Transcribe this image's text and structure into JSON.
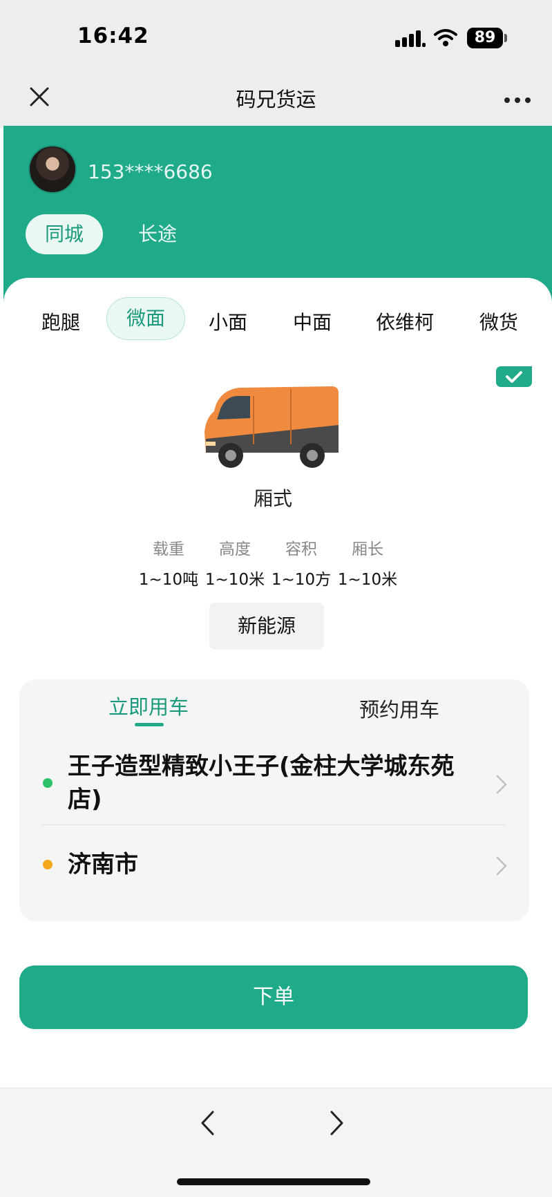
{
  "status_bar": {
    "time": "16:42",
    "battery": "89",
    "icons": [
      "signal-icon",
      "wifi-icon",
      "battery-icon"
    ]
  },
  "nav": {
    "title": "码兄货运",
    "close_icon": "close-icon",
    "more_icon": "more-icon"
  },
  "user": {
    "phone": "153****6686"
  },
  "trip_tabs": [
    {
      "label": "同城",
      "active": true
    },
    {
      "label": "长途",
      "active": false
    }
  ],
  "vehicle_types": [
    {
      "label": "跑腿",
      "active": false
    },
    {
      "label": "微面",
      "active": true
    },
    {
      "label": "小面",
      "active": false
    },
    {
      "label": "中面",
      "active": false
    },
    {
      "label": "依维柯",
      "active": false
    },
    {
      "label": "微货",
      "active": false
    }
  ],
  "vehicle": {
    "name": "厢式",
    "selected_icon": "check-icon",
    "van_color": "#f08a3e",
    "specs": [
      {
        "label": "载重",
        "value": "1~10吨"
      },
      {
        "label": "高度",
        "value": "1~10米"
      },
      {
        "label": "容积",
        "value": "1~10方"
      },
      {
        "label": "厢长",
        "value": "1~10米"
      }
    ],
    "energy_button": "新能源"
  },
  "booking": {
    "tab_now": "立即用车",
    "tab_reserve": "预约用车",
    "pickup": "王子造型精致小王子(金柱大学城东苑店)",
    "pickup_dot_color": "#2ec26b",
    "destination": "济南市",
    "destination_dot_color": "#f4a81c"
  },
  "order_button": "下单",
  "colors": {
    "brand_green": "#1faa8a",
    "brand_green_text": "#1a9a7c"
  }
}
